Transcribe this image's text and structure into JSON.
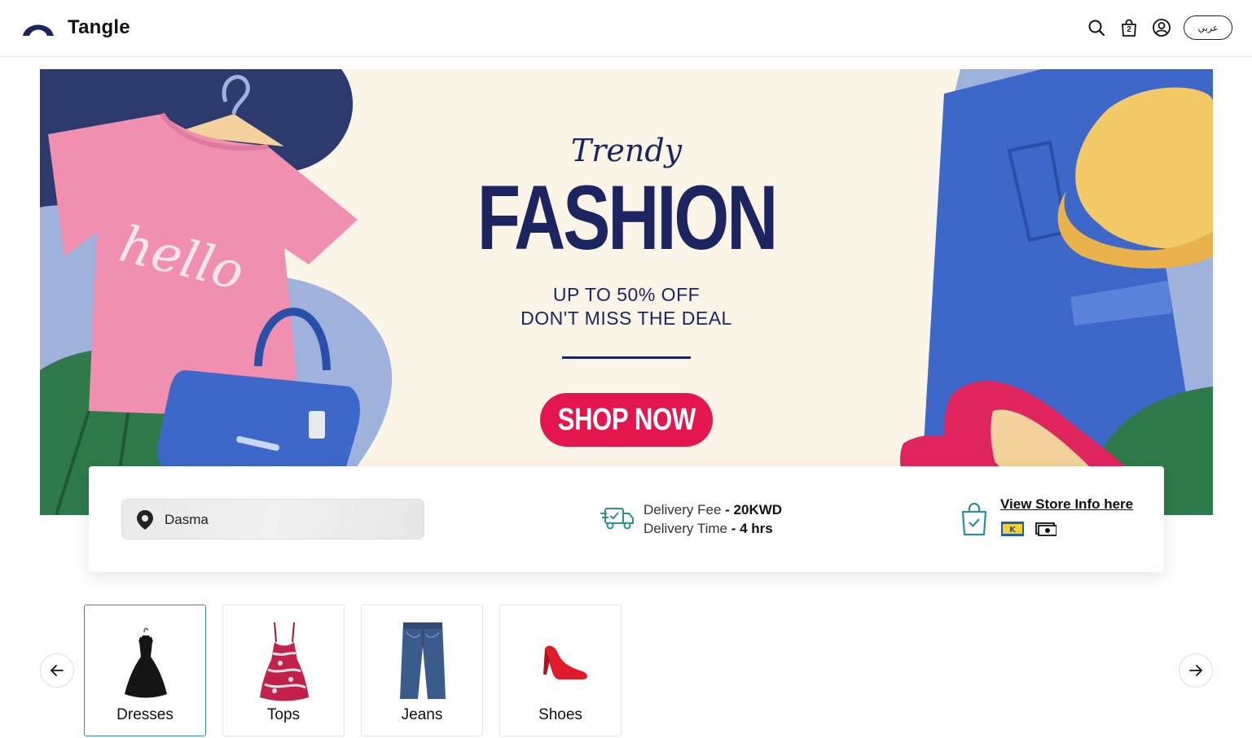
{
  "header": {
    "brand": "Tangle",
    "cart_count": "2",
    "language_label": "عربي"
  },
  "banner": {
    "script_title": "Trendy",
    "title": "FASHION",
    "promo_line1": "UP TO 50% OFF",
    "promo_line2": "DON'T MISS THE DEAL",
    "cta": "SHOP NOW",
    "tshirt_text": "hello"
  },
  "store_info": {
    "location": "Dasma",
    "delivery_fee_label": "Delivery Fee",
    "delivery_fee_value": "- 20KWD",
    "delivery_time_label": "Delivery Time",
    "delivery_time_value": "- 4 hrs",
    "store_link": "View Store Info here"
  },
  "categories": [
    {
      "label": "Dresses",
      "icon": "dress-icon",
      "active": true
    },
    {
      "label": "Tops",
      "icon": "top-icon",
      "active": false
    },
    {
      "label": "Jeans",
      "icon": "jeans-icon",
      "active": false
    },
    {
      "label": "Shoes",
      "icon": "shoe-icon",
      "active": false
    }
  ],
  "colors": {
    "brand_navy": "#1c2560",
    "cta_red": "#e3174e",
    "accent_teal": "#2a8f98"
  }
}
